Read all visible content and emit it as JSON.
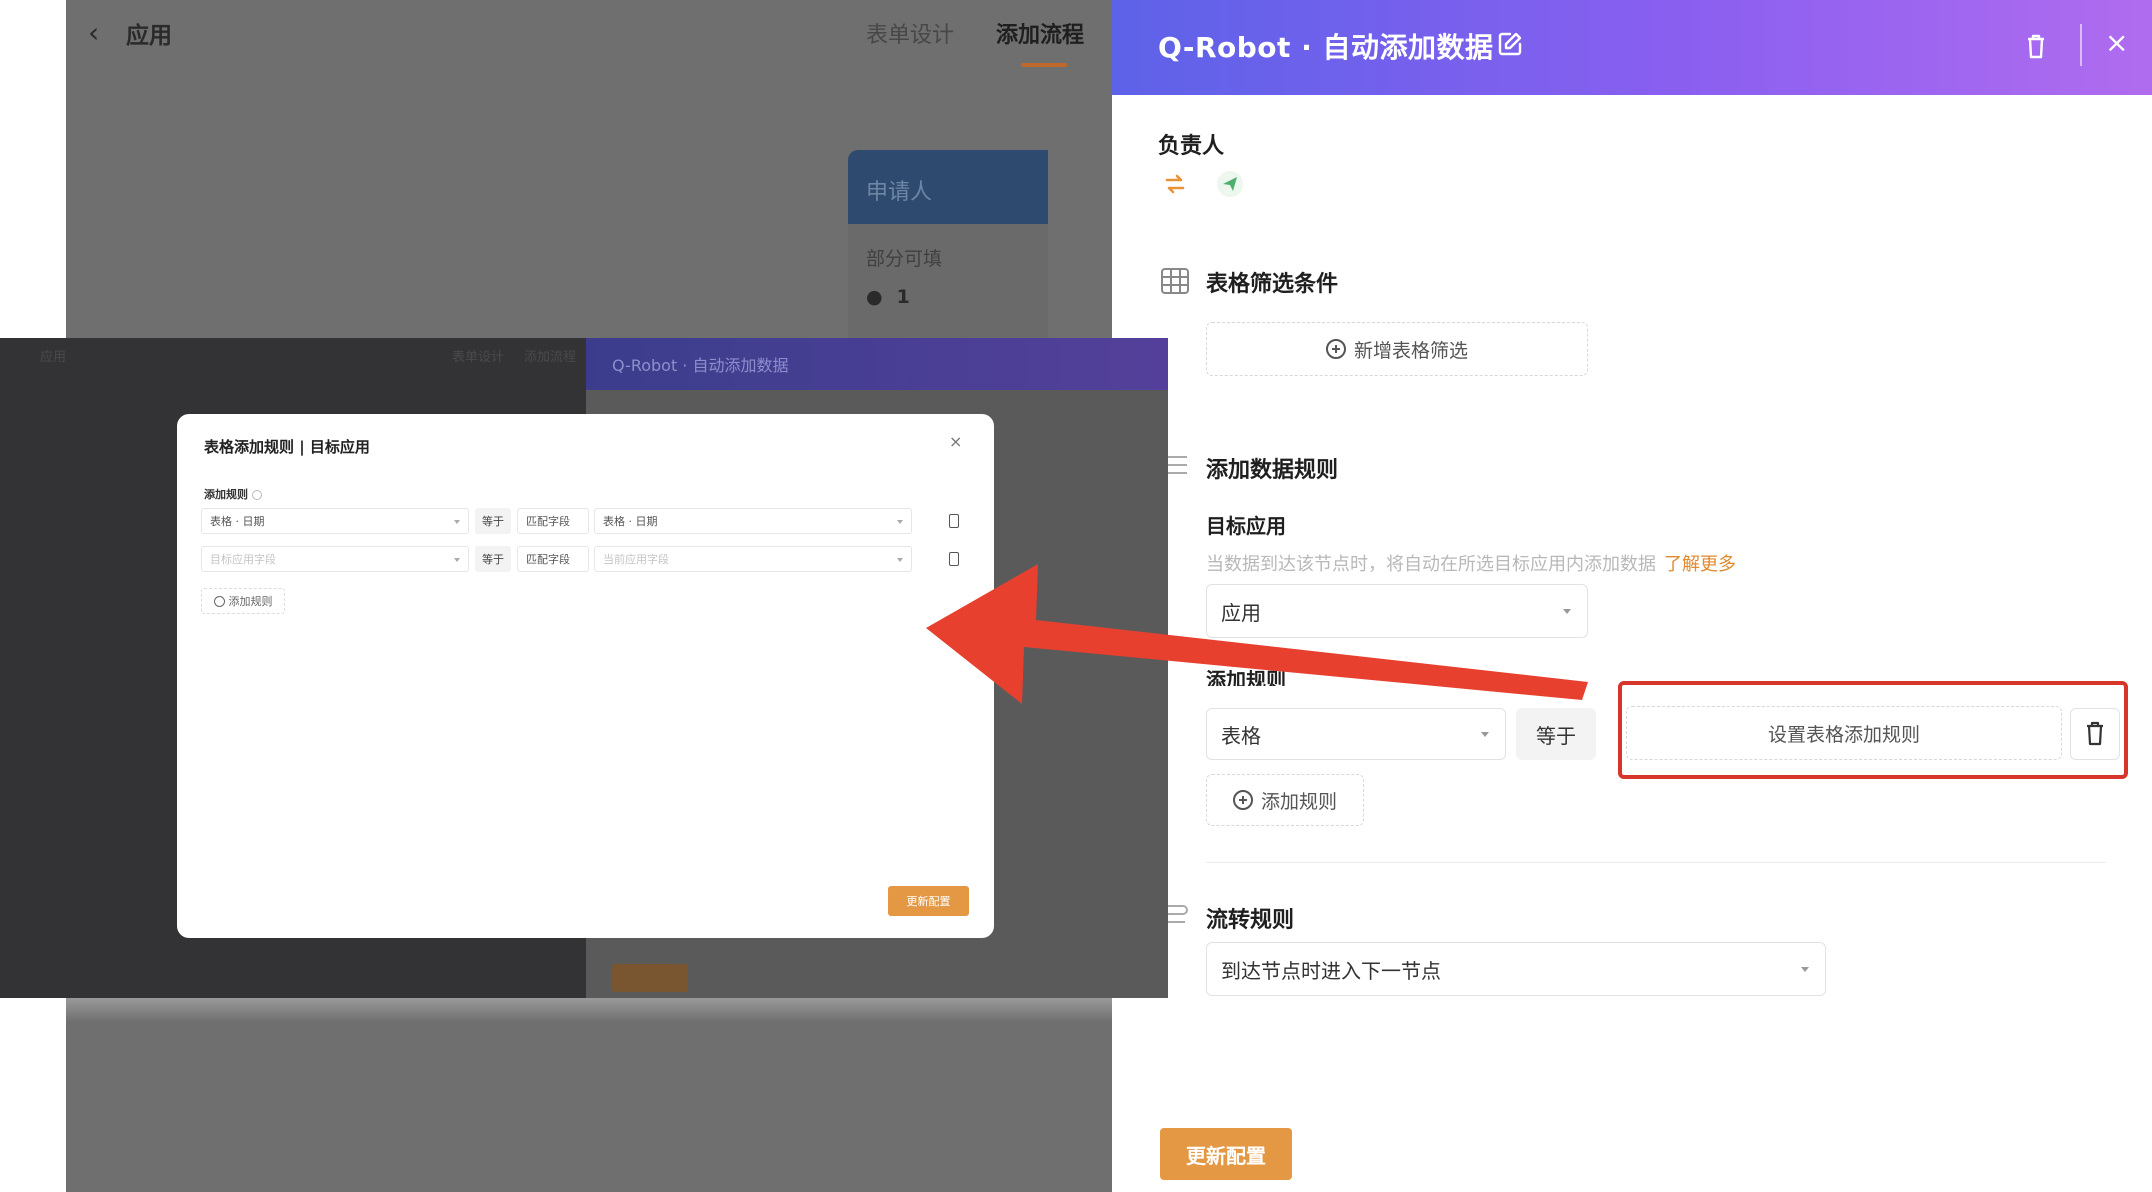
{
  "background_app": {
    "back_icon": "chevron-left-icon",
    "title": "应用",
    "tabs": [
      {
        "label": "表单设计",
        "active": false
      },
      {
        "label": "添加流程",
        "active": true
      }
    ],
    "node": {
      "title": "申请人",
      "subtitle": "部分可填",
      "view_icon": "eye-icon",
      "count": "1"
    }
  },
  "panel": {
    "title": "Q-Robot · 自动添加数据",
    "edit_icon": "edit-icon",
    "trash_icon": "trash-icon",
    "close_label": "×",
    "owner": {
      "label": "负责人",
      "icons": [
        "swap-icon",
        "send-icon"
      ]
    },
    "filter": {
      "label": "表格筛选条件",
      "icon": "table-icon",
      "add_button": "新增表格筛选"
    },
    "add_rules": {
      "label": "添加数据规则",
      "icon": "list-icon",
      "target_label": "目标应用",
      "helper_text": "当数据到达该节点时，将自动在所选目标应用内添加数据",
      "helper_link": "了解更多",
      "target_value": "应用",
      "rule_label": "添加规则",
      "rule_field_value": "表格",
      "equals": "等于",
      "set_rule_button": "设置表格添加规则",
      "add_rule_button": "添加规则"
    },
    "flow": {
      "label": "流转规则",
      "icon": "flow-icon",
      "value": "到达节点时进入下一节点"
    },
    "update_button": "更新配置"
  },
  "inset": {
    "top_labels": [
      "应用",
      "表单设计",
      "添加流程"
    ],
    "header_title": "Q-Robot · 自动添加数据",
    "modal": {
      "title": "表格添加规则 | 目标应用",
      "close_label": "×",
      "rules_label": "添加规则",
      "rows": [
        {
          "left": "表格 · 日期",
          "equals": "等于",
          "mode": "匹配字段",
          "right": "表格 · 日期",
          "placeholder": false
        },
        {
          "left": "目标应用字段",
          "equals": "等于",
          "mode": "匹配字段",
          "right": "当前应用字段",
          "placeholder": true
        }
      ],
      "add_rule_button": "添加规则",
      "update_button": "更新配置"
    }
  },
  "colors": {
    "header_gradient_start": "#5d62e8",
    "header_gradient_end": "#b06cef",
    "accent_orange": "#e49844",
    "highlight_red": "#d7352a",
    "arrow_red": "#e8402e"
  }
}
